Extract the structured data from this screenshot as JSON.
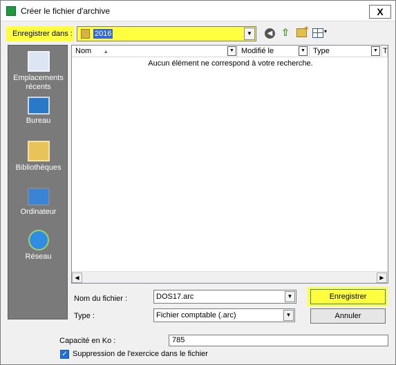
{
  "window": {
    "title": "Créer le fichier d'archive",
    "close_label": "X"
  },
  "toolbar": {
    "save_in_label": "Enregistrer dans :",
    "current_folder": "2016",
    "view_arrow": "▾"
  },
  "places": [
    {
      "line1": "Emplacements",
      "line2": "récents"
    },
    {
      "line1": "Bureau",
      "line2": ""
    },
    {
      "line1": "Bibliothèques",
      "line2": ""
    },
    {
      "line1": "Ordinateur",
      "line2": ""
    },
    {
      "line1": "Réseau",
      "line2": ""
    }
  ],
  "filelist": {
    "columns": [
      {
        "label": "Nom",
        "sort": "▲"
      },
      {
        "label": "Modifié le"
      },
      {
        "label": "Type"
      },
      {
        "label": "T"
      }
    ],
    "empty_message": "Aucun élément ne correspond à votre recherche."
  },
  "form": {
    "filename_label": "Nom du fichier :",
    "filename_value": "DOS17.arc",
    "type_label": "Type :",
    "type_value": "Fichier comptable (.arc)",
    "save_button": "Enregistrer",
    "cancel_button": "Annuler",
    "capacity_label": "Capacité en Ko :",
    "capacity_value": "785",
    "delete_checkbox_label": "Suppression de l'exercice dans le fichier",
    "delete_checkbox_checked": true
  },
  "colors": {
    "highlight": "#ffff40",
    "accent": "#3367d6",
    "places_bg": "#7a7a7a"
  }
}
